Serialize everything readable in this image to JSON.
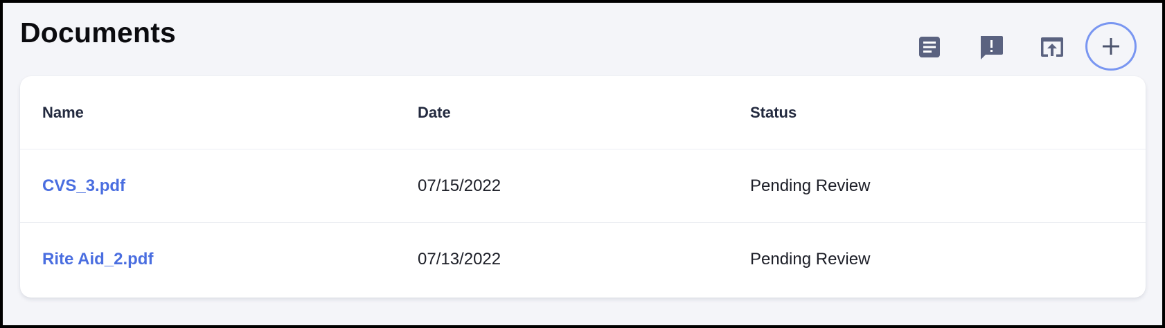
{
  "page": {
    "title": "Documents"
  },
  "colors": {
    "icon": "#5a6280",
    "accent_ring": "#7996f1",
    "link": "#4a6ee0",
    "background": "#f4f5f9"
  },
  "toolbar": {
    "icons": [
      "notes-icon",
      "feedback-icon",
      "open-in-new-icon",
      "plus-icon"
    ]
  },
  "table": {
    "columns": [
      "Name",
      "Date",
      "Status"
    ],
    "rows": [
      {
        "name": "CVS_3.pdf",
        "date": "07/15/2022",
        "status": "Pending Review"
      },
      {
        "name": "Rite Aid_2.pdf",
        "date": "07/13/2022",
        "status": "Pending Review"
      }
    ]
  }
}
